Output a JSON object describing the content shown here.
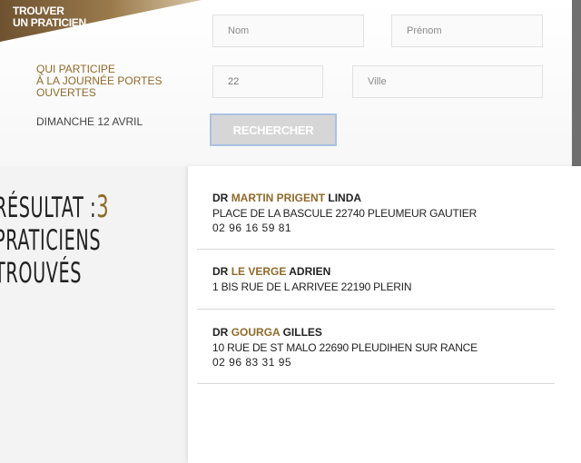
{
  "header": {
    "title_line1": "TROUVER",
    "title_line2": "UN PRATICIEN"
  },
  "form": {
    "nom_placeholder": "Nom",
    "prenom_placeholder": "Prénom",
    "department_value": "22",
    "ville_placeholder": "Ville",
    "open_day_label_line1": "QUI PARTICIPE",
    "open_day_label_line2": "À LA JOURNÉE PORTES",
    "open_day_label_line3": "OUVERTES",
    "date_label": "DIMANCHE 12 AVRIL",
    "search_button": "RECHERCHER"
  },
  "summary": {
    "prefix": "RÉSULTAT :",
    "count": "3",
    "line2": "PRATICIENS",
    "line3": "TROUVÉS"
  },
  "results": [
    {
      "title": "DR",
      "last_name": "MARTIN PRIGENT",
      "first_name": "LINDA",
      "address": "PLACE DE LA BASCULE 22740 PLEUMEUR GAUTIER",
      "phone": "02 96 16 59 81"
    },
    {
      "title": "DR",
      "last_name": "LE VERGE",
      "first_name": "ADRIEN",
      "address": "1 BIS RUE DE L ARRIVEE 22190 PLERIN",
      "phone": ""
    },
    {
      "title": "DR",
      "last_name": "GOURGA",
      "first_name": "GILLES",
      "address": "10 RUE DE ST MALO 22690 PLEUDIHEN SUR RANCE",
      "phone": "02 96 83 31 95"
    }
  ],
  "colors": {
    "accent_gold": "#8e6a2b",
    "banner_brown": "#7a5c34",
    "button_bg": "#d6d6d6",
    "button_border": "#a9c2e2"
  }
}
